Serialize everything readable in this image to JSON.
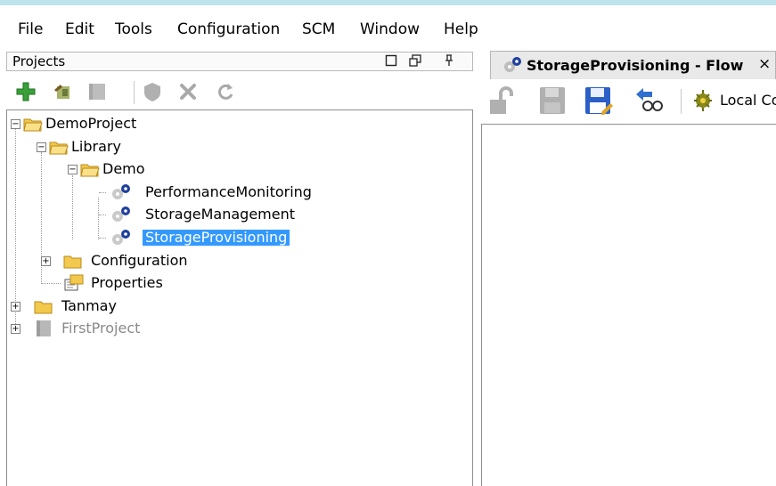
{
  "menu": {
    "items": [
      "File",
      "Edit",
      "Tools",
      "Configuration",
      "SCM",
      "Window",
      "Help"
    ]
  },
  "projects_panel": {
    "title": "Projects",
    "header_icons": [
      "restore-window-icon",
      "float-window-icon",
      "pin-icon"
    ],
    "toolbar": [
      "add-icon",
      "import-icon",
      "archive-icon",
      "shield-icon",
      "delete-icon",
      "refresh-icon"
    ]
  },
  "tree": {
    "demo_project": "DemoProject",
    "library": "Library",
    "demo": "Demo",
    "flow_1": "PerformanceMonitoring",
    "flow_2": "StorageManagement",
    "flow_3": "StorageProvisioning",
    "configuration": "Configuration",
    "properties": "Properties",
    "tanmay": "Tanmay",
    "first_project": "FirstProject"
  },
  "editor": {
    "tab_title": "StorageProvisioning - Flow",
    "tab_close": "×",
    "toolbar": [
      "unlock-icon",
      "save-icon",
      "save-as-icon",
      "compare-icon",
      "local-icon"
    ],
    "local_label": "Local Co"
  },
  "colors": {
    "selection": "#3399ff",
    "folder": "#f2c94c",
    "add": "#3aa03a",
    "gear": "#1f3f9b"
  }
}
